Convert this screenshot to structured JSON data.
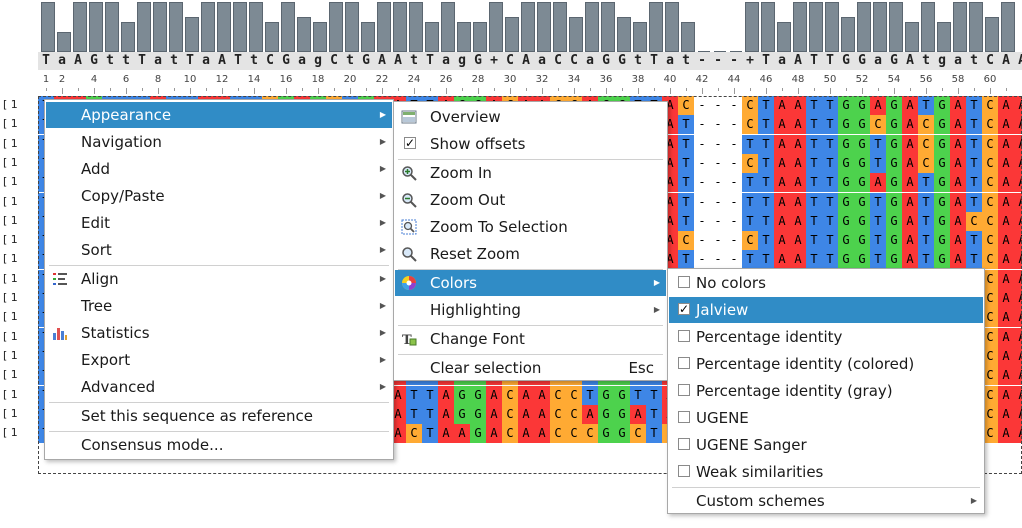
{
  "colors": {
    "A": "#fb3737",
    "C": "#ffaa33",
    "G": "#4dd24d",
    "T": "#3e86e6",
    "accent": "#308cc6",
    "histogram": "#7d8a94"
  },
  "consensus": "TaAGttTatTaATtCGagCtGAAtTagG+CAaCCaGGtTat---+TaATTGGaGAtgatCAA",
  "histogram_levels": [
    1.0,
    0.4,
    1.0,
    1.0,
    1.0,
    0.6,
    1.0,
    1.0,
    1.0,
    0.7,
    1.0,
    1.0,
    1.0,
    1.0,
    0.6,
    1.0,
    0.7,
    0.6,
    1.0,
    1.0,
    0.6,
    1.0,
    1.0,
    1.0,
    0.6,
    1.0,
    0.6,
    0.6,
    1.0,
    0.7,
    1.0,
    1.0,
    1.0,
    0.7,
    1.0,
    1.0,
    0.7,
    0.6,
    1.0,
    1.0,
    0.6,
    0.0,
    0.0,
    0.0,
    1.0,
    1.0,
    0.6,
    1.0,
    1.0,
    1.0,
    0.7,
    1.0,
    1.0,
    1.0,
    0.6,
    1.0,
    0.6,
    1.0,
    1.0,
    0.7,
    1.0
  ],
  "ruler": {
    "numbers": [
      "1",
      "2",
      "4",
      "6",
      "8",
      "10",
      "12",
      "14",
      "16",
      "18",
      "20",
      "22",
      "24",
      "26",
      "28",
      "30",
      "32",
      "34",
      "36",
      "38",
      "40",
      "42",
      "44",
      "46",
      "48",
      "50",
      "52",
      "54",
      "56",
      "58",
      "60"
    ]
  },
  "rows": [
    "TAAGTTTATTAATTCGAGCTGAATTAGGACAACCAGGTTAC---CTAATTGGAGATGATCAA",
    "TAAGTTTATTAATTCGAGCTGAATTAGGACAACCAGGTTAT---CTAATTGGCGACGATCAA",
    "TAAGTTTATTAATTCGAGCTGAATTAGGACAACCAGGTTAT---TTAATTGGTGACGATCAA",
    "TAAGTTTATTAATTCGAGCTGAATTAGGACAACCAGGTTAT---CTAATTGGTGACGATCAA",
    "TAAGTTTATTAATTCGAGCTGAATTAGGACAACCAGGTTAT---TTAATTGGAGATGATCAA",
    "TAAGTTTATTAATTCGAGCTGAATTAGGACAACCAGGTTAT---TTAATTGGTGATGATCAA",
    "TAAGTTTATTAATTCGAGCTGAATTAGGACAACCAGGTTAT---TTAATTGGTGATGACCAA",
    "TAAGTTTATTAATTCGAGCTGAATTAGGACAACCAGGTTAC---CTAATTGGTGATGATCAA",
    "TAAGTTTATTAATTCGAGCTGAATTAGGACAACCAGGTTAT---TTAATTGGTGATGATCAA",
    "TAAGTTTATTAATTCGAGCTGAATTAGGACAACCAGGTTAT---TTAATTGGTGATGATCAA",
    "TAAGTTTATTAATTCGAGCTGAATTAGGACAACCAGGTTAT---TTAATTGGTGATGATCAA",
    "TAAGTTTATTAATTCGAGCTGAATTAGGACAACCAGGTTAT---TTAATTGGTGATGATCAA",
    "TAAGTTTATTAATTCGAGCTGAATTAGGACAACCAGGTTAT---TTAATTGGTGATGATCAA",
    "TAAGTTTATTAATTCGAGCTGAATTAGGACAACCAGGTTAT---TTAATTGGTGATGATCAA",
    "TAAGTTTATTAATTCGAGCTGAATTAGGACAACCTGGTTAT---TTAATTGGTGATGATCAA",
    "TAAGTTTATTAATTCGAGCTGAATTAGGACAACCTGGTTAT---TTAATTGGTGATGATCAA",
    "TAAGTTTATTAATTCGAGCTGAATTAGGACAACCAGGATAT---TTAATTGGTGATGATCAA",
    "TAAGCCTTTTAATTCGTTCAGAACTAAGACAACCCGGCTCT---TTAATTGGTGATGATCAA"
  ],
  "gutter": {
    "row_label": "1"
  },
  "menu_main": {
    "items": [
      {
        "label": "Appearance",
        "submenu": true,
        "active": true
      },
      {
        "label": "Navigation",
        "submenu": true
      },
      {
        "label": "Add",
        "submenu": true
      },
      {
        "label": "Copy/Paste",
        "submenu": true
      },
      {
        "label": "Edit",
        "submenu": true
      },
      {
        "label": "Sort",
        "submenu": true
      },
      {
        "label": "Align",
        "submenu": true,
        "icon": "align-icon"
      },
      {
        "label": "Tree",
        "submenu": true
      },
      {
        "label": "Statistics",
        "submenu": true,
        "icon": "statistics-icon"
      },
      {
        "label": "Export",
        "submenu": true
      },
      {
        "label": "Advanced",
        "submenu": true
      },
      {
        "label": "Set this sequence as reference"
      },
      {
        "label": "Consensus mode..."
      }
    ]
  },
  "menu_appearance": {
    "items": [
      {
        "label": "Overview",
        "icon": "overview-icon"
      },
      {
        "label": "Show offsets",
        "checked": true
      },
      {
        "label": "Zoom In",
        "icon": "zoom-in-icon"
      },
      {
        "label": "Zoom Out",
        "icon": "zoom-out-icon"
      },
      {
        "label": "Zoom To Selection",
        "icon": "zoom-to-selection-icon"
      },
      {
        "label": "Reset Zoom",
        "icon": "reset-zoom-icon"
      },
      {
        "label": "Colors",
        "icon": "colors-icon",
        "submenu": true,
        "active": true
      },
      {
        "label": "Highlighting",
        "submenu": true
      },
      {
        "label": "Change Font",
        "icon": "change-font-icon"
      },
      {
        "label": "Clear selection",
        "shortcut": "Esc"
      }
    ]
  },
  "menu_colors": {
    "items": [
      {
        "label": "No colors",
        "checked": false
      },
      {
        "label": "Jalview",
        "checked": true,
        "active": true
      },
      {
        "label": "Percentage identity",
        "checked": false
      },
      {
        "label": "Percentage identity (colored)",
        "checked": false
      },
      {
        "label": "Percentage identity (gray)",
        "checked": false
      },
      {
        "label": "UGENE",
        "checked": false
      },
      {
        "label": "UGENE Sanger",
        "checked": false
      },
      {
        "label": "Weak similarities",
        "checked": false
      },
      {
        "label": "Custom schemes",
        "submenu": true
      }
    ]
  }
}
